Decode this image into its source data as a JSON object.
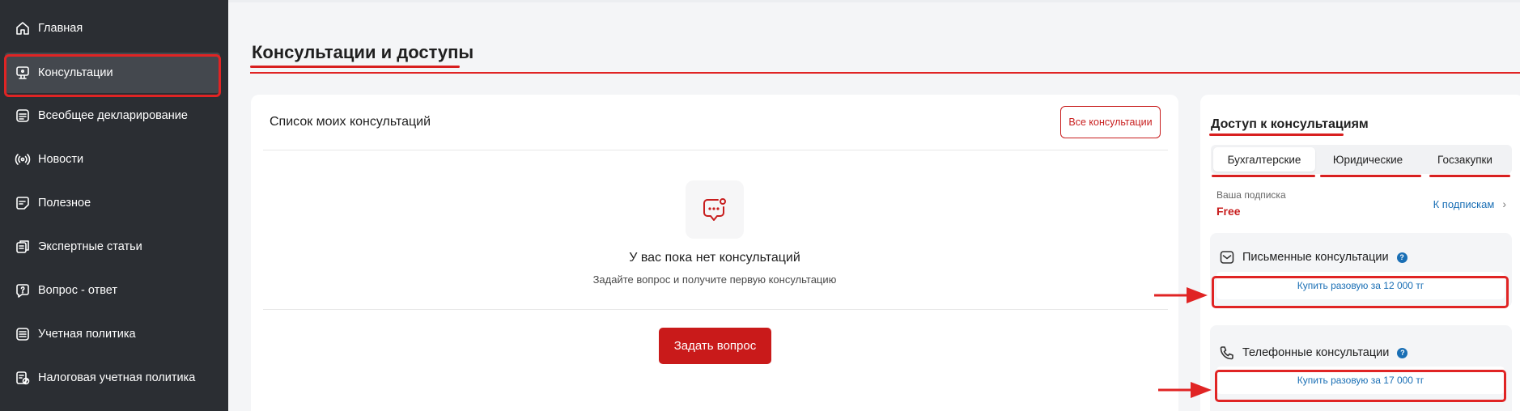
{
  "sidebar": {
    "items": [
      {
        "label": "Главная",
        "icon": "home-icon"
      },
      {
        "label": "Консультации",
        "icon": "chat-monitor-icon"
      },
      {
        "label": "Всеобщее декларирование",
        "icon": "document-icon"
      },
      {
        "label": "Новости",
        "icon": "broadcast-icon"
      },
      {
        "label": "Полезное",
        "icon": "note-icon"
      },
      {
        "label": "Экспертные статьи",
        "icon": "articles-icon"
      },
      {
        "label": "Вопрос - ответ",
        "icon": "question-icon"
      },
      {
        "label": "Учетная политика",
        "icon": "list-icon"
      },
      {
        "label": "Налоговая учетная политика",
        "icon": "tax-icon"
      }
    ],
    "active_index": 1
  },
  "page": {
    "title": "Консультации и доступы"
  },
  "consultations": {
    "title": "Список моих консультаций",
    "all_button": "Все консультации",
    "empty_title": "У вас пока нет консультаций",
    "empty_subtitle": "Задайте вопрос и получите первую консультацию",
    "ask_button": "Задать вопрос"
  },
  "access": {
    "title": "Доступ к консультациям",
    "tabs": [
      "Бухгалтерские",
      "Юридические",
      "Госзакупки"
    ],
    "active_tab": 0,
    "subscription_label": "Ваша подписка",
    "subscription_value": "Free",
    "subscriptions_link": "К подпискам",
    "written": {
      "title": "Письменные консультации",
      "buy": "Купить разовую за 12 000 тг"
    },
    "phone": {
      "title": "Телефонные консультации",
      "buy": "Купить разовую за 17 000 тг"
    }
  },
  "colors": {
    "accent": "#c81e1e",
    "link": "#1a6fb5",
    "sidebar_bg": "#2b2e33"
  }
}
